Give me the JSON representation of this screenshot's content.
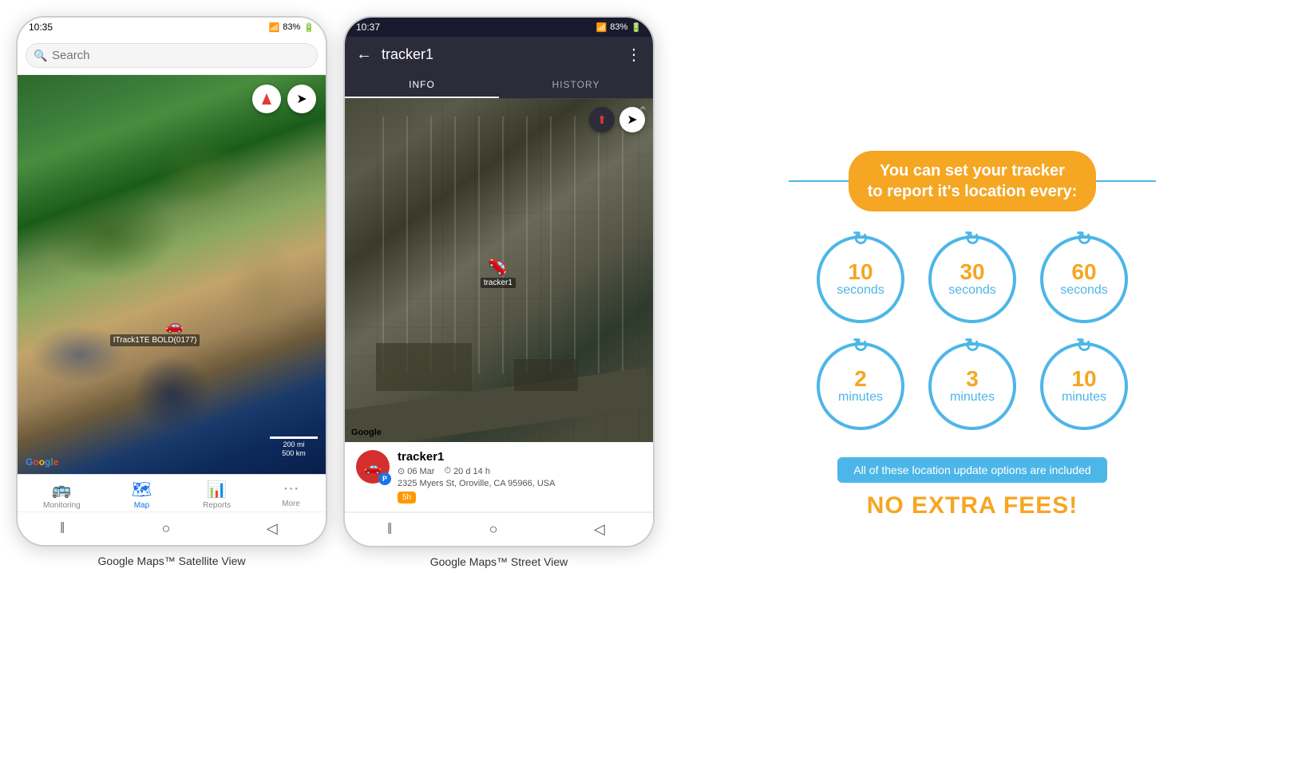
{
  "phone1": {
    "status_time": "10:35",
    "status_signal": "📶",
    "status_battery": "83%",
    "search_placeholder": "Search",
    "map_label": "ITrack1TE BOLD(0177)",
    "google_logo": "Google",
    "scale_200mi": "200 mi",
    "scale_500km": "500 km",
    "nav_items": [
      {
        "label": "Monitoring",
        "icon": "🚌",
        "active": false
      },
      {
        "label": "Map",
        "icon": "🗺",
        "active": true
      },
      {
        "label": "Reports",
        "icon": "📊",
        "active": false
      },
      {
        "label": "More",
        "icon": "···",
        "active": false
      }
    ],
    "caption": "Google Maps™ Satellite View"
  },
  "phone2": {
    "status_time": "10:37",
    "status_signal": "📶",
    "status_battery": "83%",
    "header_title": "tracker1",
    "tab_info": "INFO",
    "tab_history": "HISTORY",
    "tracker_name": "tracker1",
    "tracker_date": "06 Mar",
    "tracker_duration": "20 d 14 h",
    "tracker_address": "2325 Myers St, Oroville, CA 95966, USA",
    "tracker_badge": "5h",
    "tracker_label": "tracker1",
    "google_logo": "Google",
    "caption": "Google Maps™ Street View"
  },
  "infographic": {
    "title_line1": "You can set your tracker",
    "title_line2": "to report it's location every:",
    "circles": [
      {
        "number": "10",
        "unit": "seconds"
      },
      {
        "number": "30",
        "unit": "seconds"
      },
      {
        "number": "60",
        "unit": "seconds"
      },
      {
        "number": "2",
        "unit": "minutes"
      },
      {
        "number": "3",
        "unit": "minutes"
      },
      {
        "number": "10",
        "unit": "minutes"
      }
    ],
    "included_text": "All of these location update options are included",
    "no_fees_text": "NO EXTRA FEES!"
  }
}
